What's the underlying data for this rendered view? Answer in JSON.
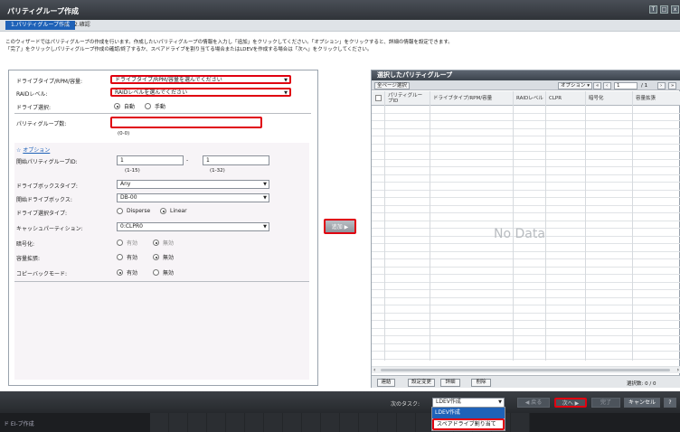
{
  "window": {
    "title": "パリティグループ作成",
    "btn1": "T",
    "btn2": "□",
    "btn3": "x"
  },
  "crumbs": {
    "step1": "1.パリティグループ作成",
    "sep": ">",
    "step2": "2.確認"
  },
  "intro": {
    "line1": "このウィザードではパリティグループの作成を行います。作成したいパリティグループの情報を入力し「追加」をクリックしてください。「オプション」をクリックすると、詳細の情報を設定できます。",
    "line2": "「完了」をクリックしパリティグループ作成の確認/終了するか、スペアドライブを割り当てる場合またはLDEVを作成する場合は「次へ」をクリックしてください。"
  },
  "form": {
    "drive_type_label": "ドライブタイプ/RPM/容量:",
    "drive_type_value": "ドライブタイプ/RPM/容量を選んでください",
    "raid_label": "RAIDレベル:",
    "raid_value": "RAIDレベルを選んでください",
    "drive_select_label": "ドライブ選択:",
    "auto": "自動",
    "manual": "手動",
    "pg_count_label": "パリティグループ数:",
    "pg_count_value": "",
    "pg_count_range": "(0-0)",
    "options_toggle": "オプション",
    "start_pg_label": "開始パリティグループID:",
    "start_pg_1": "1",
    "start_pg_dash": "-",
    "start_pg_2": "1",
    "start_range1": "(1-15)",
    "start_range2": "(1-32)",
    "drivebox_type_label": "ドライブボックスタイプ:",
    "drivebox_type_value": "Any",
    "start_drivebox_label": "開始ドライブボックス:",
    "start_drivebox_value": "DB-00",
    "drive_select_type_label": "ドライブ選択タイプ:",
    "disperse": "Disperse",
    "linear": "Linear",
    "cache_label": "キャッシュパーティション:",
    "cache_value": "0:CLPR0",
    "encrypt_label": "暗号化:",
    "enabled": "有効",
    "disabled": "無効",
    "expand_label": "容量拡張:",
    "copyback_label": "コピーバックモード:"
  },
  "add_button": "追加 ▶",
  "right": {
    "title": "選択したパリティグループ",
    "select_all": "全ページ選択",
    "options": "オプション ▾",
    "page_value": "1",
    "page_total": "/ 1",
    "columns": [
      "パリティグルー\nプID",
      "ドライブタイプ/RPM/容量",
      "RAIDレベル",
      "CLPR",
      "暗号化",
      "容量拡張"
    ],
    "no_data": "No Data",
    "btn_link": "連結",
    "btn_change": "設定変更",
    "btn_detail": "詳細",
    "btn_delete": "削除",
    "selected_count": "選択数: 0 / 0"
  },
  "bottom": {
    "next_task_label": "次のタスク:",
    "next_task_value": "LDEV作成",
    "back": "◀ 戻る",
    "next": "次へ ▶",
    "finish": "完了",
    "cancel": "キャンセル",
    "help": "?"
  },
  "dropdown": {
    "opt1": "LDEV作成",
    "opt2": "スペアドライブ割り当て"
  },
  "status": {
    "text": "ド EI-ブ作成"
  },
  "colors": {
    "accent": "#1f62b8",
    "highlight": "#e00010"
  }
}
